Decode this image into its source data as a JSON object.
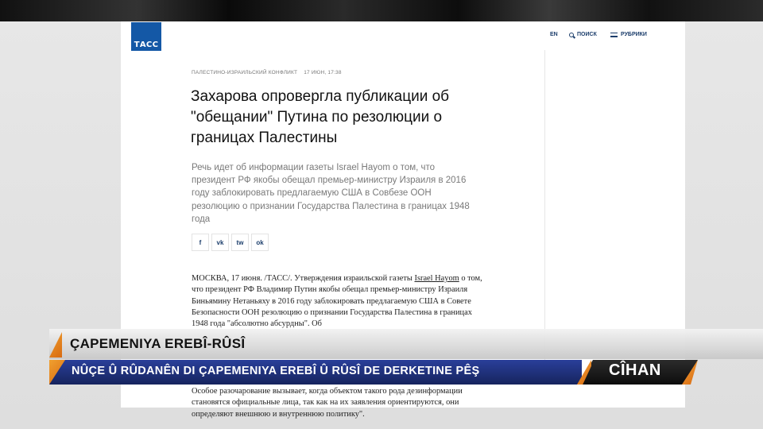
{
  "site": {
    "logo": "ТАСС",
    "nav": {
      "lang": "EN",
      "search": "ПОИСК",
      "rubrics": "РУБРИКИ"
    }
  },
  "article": {
    "category": "ПАЛЕСТИНО-ИЗРАИЛЬСКИЙ КОНФЛИКТ",
    "date": "17 ИЮН, 17:38",
    "headline": "Захарова опровергла публикации об \"обещании\" Путина по резолюции о границах Палестины",
    "lead": "Речь идет об информации газеты Israel Hayom о том, что президент РФ якобы обещал премьер-министру Израиля в 2016 году заблокировать предлагаемую США в Совбезе ООН резолюцию о признании Государства Палестина в границах 1948 года",
    "share": [
      "f",
      "vk",
      "tw",
      "ok"
    ],
    "body_pre": "МОСКВА, 17 июня. /ТАСС/. Утверждения израильской газеты ",
    "body_link": "Israel Hayom",
    "body_post": " о том, что президент РФ Владимир Путин якобы обещал премьер-министру Израиля Биньямину Нетаньяху в 2016 году заблокировать предлагаемую США в Совете Безопасности ООН резолюцию о признании Государства Палестина в границах 1948 года \"абсолютно абсурдны\". Об",
    "body_tail": "Особое разочарование вызывает, когда объектом такого рода дезинформации становятся официальные лица, так как на их заявления ориентируются, они определяют внешнюю и внутреннюю политику\"."
  },
  "lower_third": {
    "title": "ÇAPEMENIYA EREBÎ-RÛSÎ",
    "subtitle": "NÛÇE Û RÛDANÊN DI ÇAPEMENIYA EREBÎ Û RÛSÎ DE DERKETINE PÊŞ",
    "brand": "CÎHAN"
  },
  "colors": {
    "tass_blue": "#1458a6",
    "banner_blue": "#1f2f7a",
    "accent_orange": "#e8861e"
  }
}
